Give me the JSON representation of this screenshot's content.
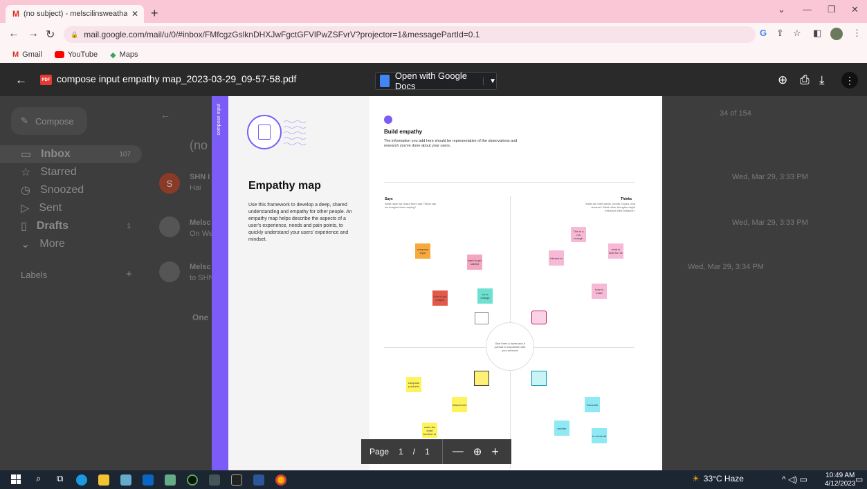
{
  "browser": {
    "tab_title": "(no subject) - melscilinsweatha©",
    "url": "mail.google.com/mail/u/0/#inbox/FMfcgzGslknDHXJwFgctGFVlPwZSFvrV?projector=1&messagePartId=0.1",
    "bookmarks": [
      "Gmail",
      "YouTube",
      "Maps"
    ]
  },
  "viewer": {
    "file_name": "compose input empathy map_2023-03-29_09-57-58.pdf",
    "open_with": "Open with Google Docs",
    "pdf_badge": "PDF"
  },
  "gmail": {
    "compose": "Compose",
    "nav": [
      {
        "label": "Inbox",
        "count": "107"
      },
      {
        "label": "Starred",
        "count": ""
      },
      {
        "label": "Snoozed",
        "count": ""
      },
      {
        "label": "Sent",
        "count": ""
      },
      {
        "label": "Drafts",
        "count": "1"
      },
      {
        "label": "More",
        "count": ""
      }
    ],
    "labels": "Labels",
    "pagination": "34 of 154",
    "subject": "(no",
    "rows": [
      {
        "sender": "SHN I",
        "preview": "Hai",
        "date": "Wed, Mar 29, 3:33 PM",
        "avatar": "S"
      },
      {
        "sender": "Melsc",
        "preview": "On We",
        "date": "Wed, Mar 29, 3:33 PM"
      },
      {
        "sender": "Melsc",
        "preview": "to SHN",
        "date": "Wed, Mar 29, 3:34 PM"
      }
    ],
    "attachment_heading": "One"
  },
  "pdf": {
    "vertical_label": "compose input",
    "title": "Empathy map",
    "description": "Use this framework to develop a deep, shared understanding and empathy for other people. An empathy map helps describe the aspects of a user's experience, needs and pain points, to quickly understand your users' experience and mindset.",
    "build_title": "Build empathy",
    "build_desc": "The information you add here should be representative of the observations and research you've done about your users.",
    "says_title": "Says",
    "says_desc": "What have we heard them say? What can we imagine them saying?",
    "thinks_title": "Thinks",
    "thinks_desc": "What are their wants, needs, hopes, and dreams? What other thoughts might influence their behavior?",
    "persona_text": "Give them a name and a portrait to empathize with your persona",
    "stickies": {
      "s1": "compose input",
      "s2": "want to get started",
      "s3": "How to put images",
      "s4": "on to change",
      "s5": "This is a not enough",
      "s6": "Interest to",
      "s7": "what is best for me",
      "s8": "how to make",
      "s9": "compose products",
      "s10": "Attachment",
      "s11": "make the chart function to",
      "s12": "Favourite",
      "s13": "wonder",
      "s14": "to check all"
    }
  },
  "page_control": {
    "label": "Page",
    "current": "1",
    "sep": "/",
    "total": "1"
  },
  "taskbar": {
    "weather": "33°C  Haze",
    "time": "10:49 AM",
    "date": "4/12/2023"
  },
  "colors": {
    "tab_bar": "#f9c7d5",
    "purple_accent": "#7b5cf6"
  }
}
